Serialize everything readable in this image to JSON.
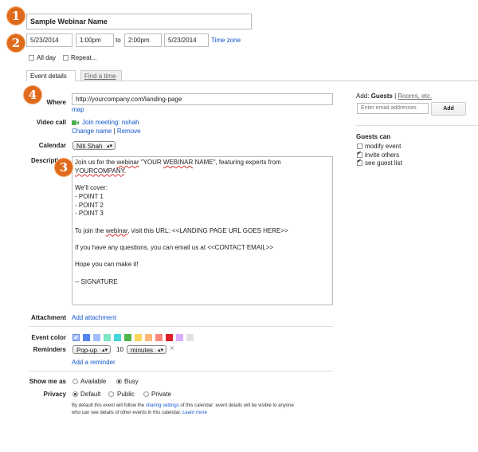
{
  "title": "Sample Webinar Name",
  "datetime": {
    "start_date": "5/23/2014",
    "start_time": "1:00pm",
    "to": "to",
    "end_time": "2:00pm",
    "end_date": "5/23/2014",
    "timezone": "Time zone"
  },
  "options": {
    "all_day": "All day",
    "repeat": "Repeat..."
  },
  "tabs": [
    {
      "label": "Event details"
    },
    {
      "label": "Find a time"
    }
  ],
  "where": {
    "label": "Where",
    "value": "http://yourcompany.com/landing-page",
    "map": "map"
  },
  "video_call": {
    "label": "Video call",
    "join": "Join meeting: nshah",
    "change": "Change name",
    "sep": "|",
    "remove": "Remove"
  },
  "calendar": {
    "label": "Calendar",
    "value": "Niti Shah"
  },
  "description": {
    "label": "Description",
    "l1a": "Join us for the ",
    "l1b": "webinar",
    "l1c": " \"YOUR ",
    "l1d": "WEBINAR",
    "l1e": " NAME\", featuring experts from",
    "l2": "YOURCOMPANY",
    "l2b": ".",
    "rest1": "\nWe'll cover:\n- POINT 1\n- POINT 2\n- POINT 3\n\nTo join the ",
    "w2": "webinar",
    "rest2": ", visit this URL: <<LANDING PAGE URL GOES HERE>>\n\nIf you have any questions, you can email us at <<CONTACT EMAIL>>\n\nHope you can make it!\n\n-- SIGNATURE"
  },
  "attachment": {
    "label": "Attachment",
    "link": "Add attachment"
  },
  "event_color": {
    "label": "Event color",
    "colors": [
      "#a4bdfc",
      "#5484ed",
      "#a4bdfc",
      "#7ae7bf",
      "#46d6db",
      "#51b749",
      "#fbd75b",
      "#ffb878",
      "#ff887c",
      "#dc2127",
      "#dbadff",
      "#e1e1e1"
    ]
  },
  "reminders": {
    "label": "Reminders",
    "type": "Pop-up",
    "number": "10",
    "unit": "minutes",
    "remove": "×",
    "add": "Add a reminder"
  },
  "show_me_as": {
    "label": "Show me as",
    "available": "Available",
    "busy": "Busy"
  },
  "privacy": {
    "label": "Privacy",
    "default": "Default",
    "public": "Public",
    "private": "Private"
  },
  "footnote": {
    "a": "By default this event will follow the ",
    "link1": "sharing settings",
    "b": " of this calendar: event details will be visible to anyone",
    "c": "who can see details of other events in this calendar. ",
    "link2": "Learn more"
  },
  "add_guests": {
    "add": "Add:",
    "guests": "Guests",
    "sep": "|",
    "rooms": "Rooms, etc.",
    "placeholder": "Enter email addresses",
    "button": "Add"
  },
  "guests_can": {
    "label": "Guests can",
    "modify": "modify event",
    "invite": "invite others",
    "see": "see guest list"
  },
  "badges": [
    "1",
    "2",
    "3",
    "4"
  ]
}
